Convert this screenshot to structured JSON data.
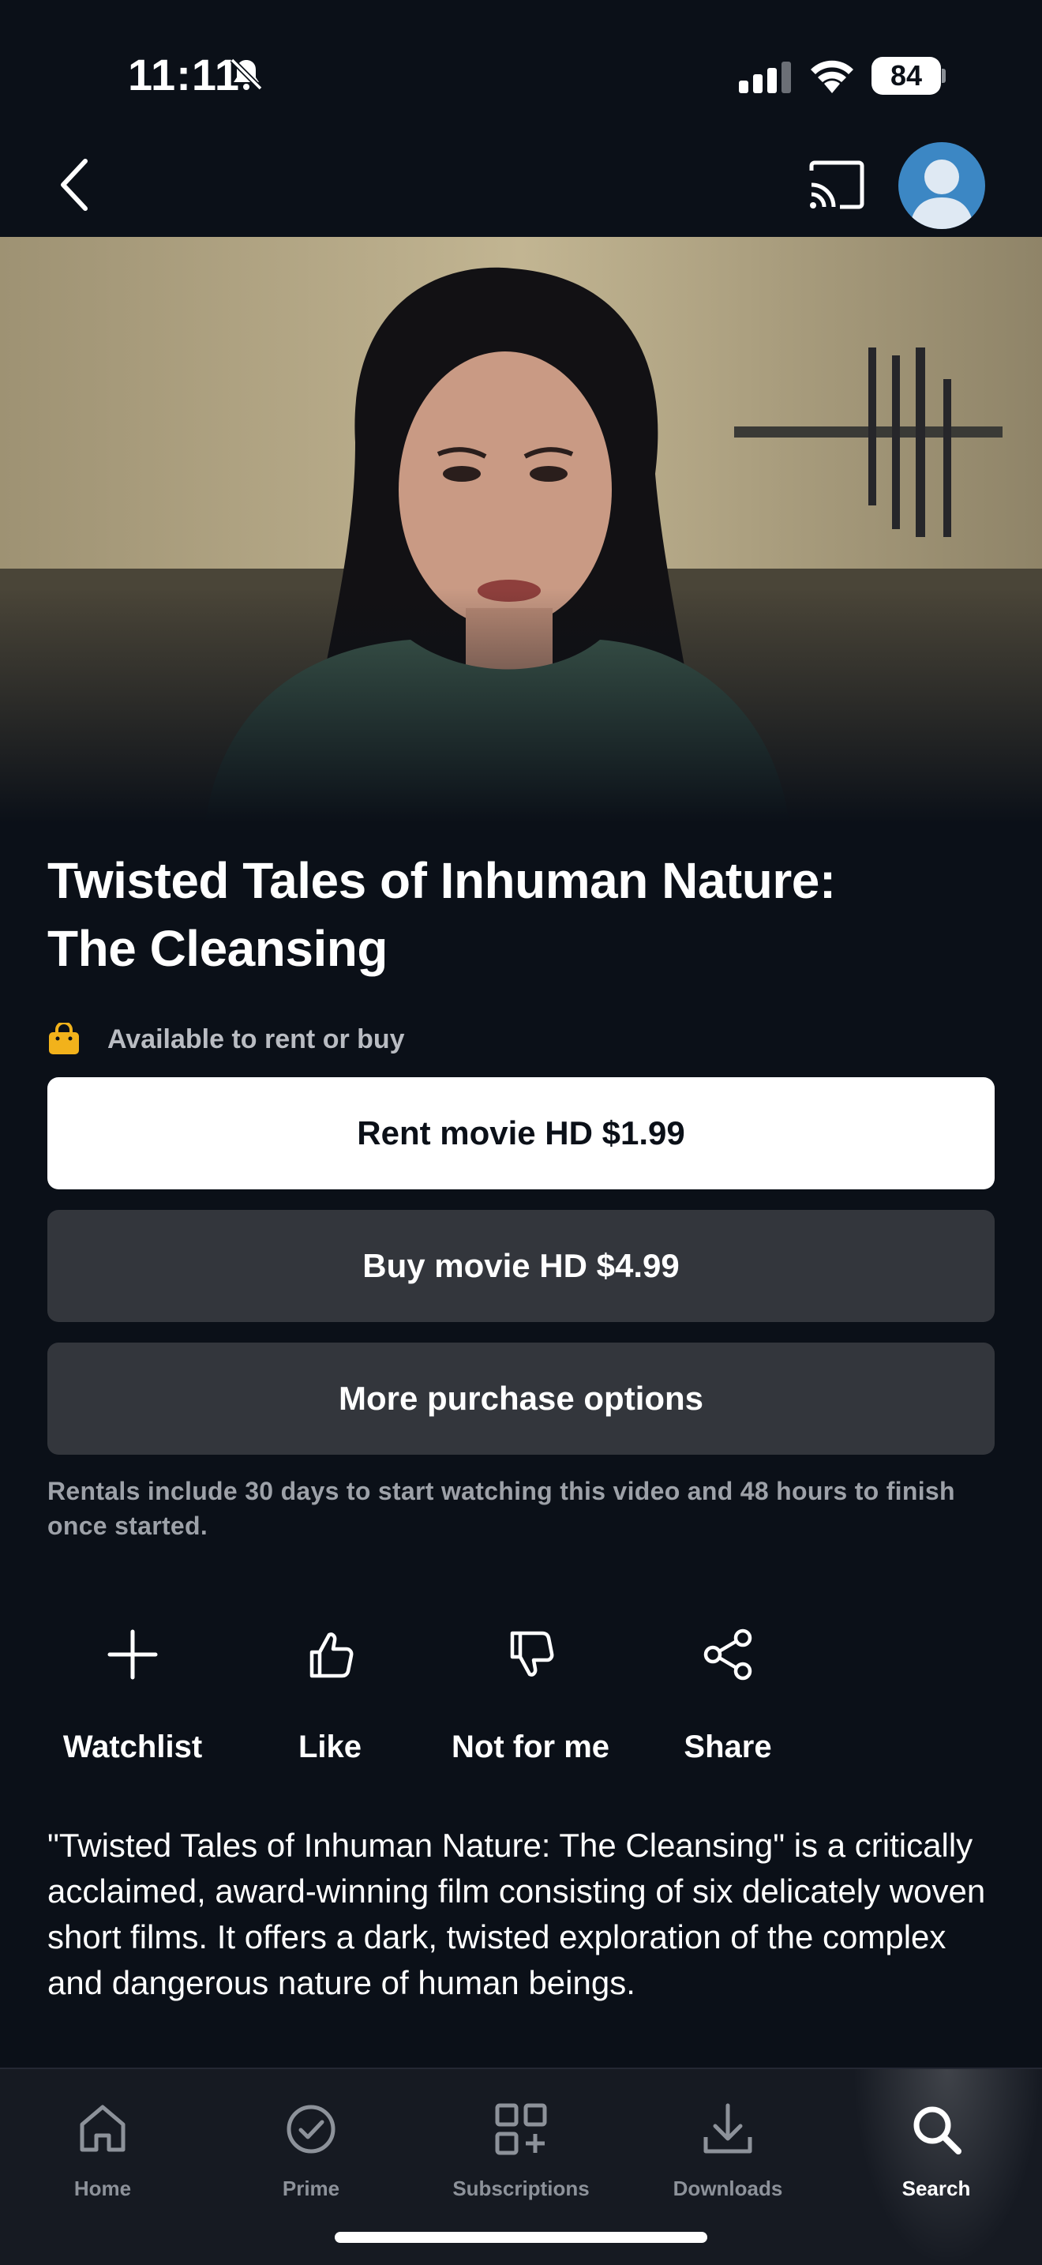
{
  "status_bar": {
    "time": "11:11",
    "battery": "84"
  },
  "nav": {
    "back_icon": "chevron-left-icon",
    "cast_icon": "cast-icon",
    "avatar_icon": "user-avatar-icon"
  },
  "movie": {
    "title_line1": "Twisted Tales of Inhuman Nature:",
    "title_line2": "The Cleansing",
    "availability": "Available to rent or buy",
    "rent_label": "Rent movie HD $1.99",
    "buy_label": "Buy movie HD $4.99",
    "more_label": "More purchase options",
    "rental_note": "Rentals include 30 days to start watching this video and 48 hours to finish once started.",
    "description": "\"Twisted Tales of Inhuman Nature: The Cleansing\" is a critically acclaimed, award-winning film consisting of six delicately woven short films. It offers a dark, twisted exploration of the complex and dangerous nature of human beings."
  },
  "actions": [
    {
      "label": "Watchlist",
      "icon": "plus-icon"
    },
    {
      "label": "Like",
      "icon": "thumbs-up-icon"
    },
    {
      "label": "Not for me",
      "icon": "thumbs-down-icon"
    },
    {
      "label": "Share",
      "icon": "share-icon"
    }
  ],
  "tabs": [
    {
      "label": "Home",
      "icon": "home-icon"
    },
    {
      "label": "Prime",
      "icon": "check-circle-icon"
    },
    {
      "label": "Subscriptions",
      "icon": "grid-plus-icon"
    },
    {
      "label": "Downloads",
      "icon": "download-icon"
    },
    {
      "label": "Search",
      "icon": "search-icon",
      "active": true
    }
  ],
  "colors": {
    "background": "#0b1018",
    "primary_button": "#ffffff",
    "secondary_button": "#33363c",
    "bag_icon": "#f2b21b",
    "muted_text": "#9da1a8"
  }
}
